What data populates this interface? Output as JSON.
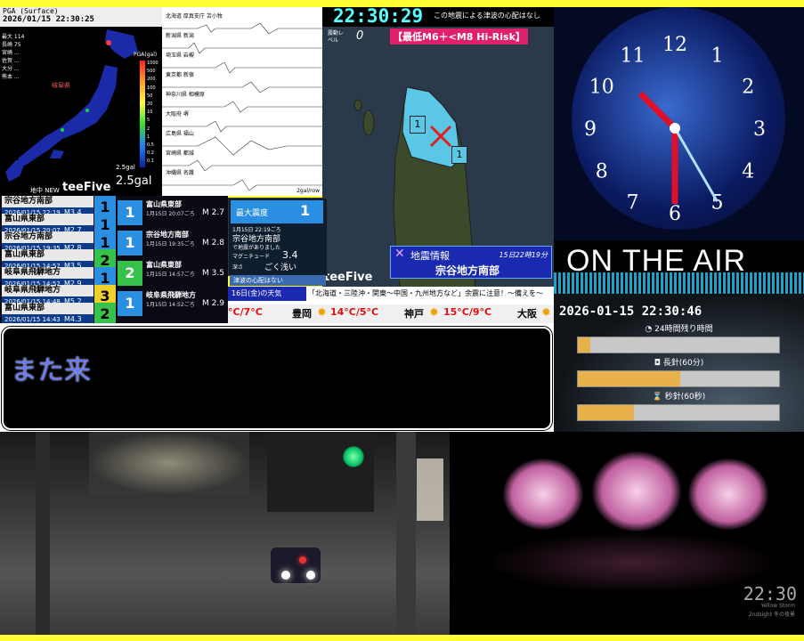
{
  "map": {
    "header": "PGA (Surface)",
    "timestamp": "2026/01/15 22:30:25",
    "scale_title": "PGA(gal)",
    "scale_ticks": [
      "1000",
      "500",
      "200",
      "100",
      "50",
      "20",
      "10",
      "5",
      "2",
      "1",
      "0.5",
      "0.2",
      "0.1"
    ],
    "threshold_label": "2.5gal",
    "max_label": "2.5gal",
    "brand": "teeFive",
    "subtitle": "地中 NEW",
    "left_list": [
      "最大 114",
      "長崎 75",
      "宮崎 ...",
      "佐賀 ...",
      "大分 ...",
      "熊本 ..."
    ]
  },
  "waves": {
    "stations": [
      "北海道 厚真支庁 苫小牧",
      "新潟県 新潟",
      "埼玉県 岩槻",
      "東京都 新宿",
      "神奈川県 相模原",
      "大阪府 堺",
      "広島県 福山",
      "宮崎県 都城",
      "沖縄県 名護"
    ],
    "footer": "2gal/row"
  },
  "quake": {
    "clock": "22:30:29",
    "tsunami_note": "この地震による津波の心配はなし",
    "level_label": "震動レベル",
    "level_value": "0",
    "risk": "【最低M6＋<M8 Hi-Risk】",
    "markers": [
      "1",
      "1"
    ],
    "info_title": "地震情報",
    "info_time": "15日22時19分",
    "region": "宗谷地方南部",
    "brand": "teeFive",
    "tsunami_footer": "津波の心配はない"
  },
  "list": {
    "rows": [
      {
        "name": "宗谷地方南部",
        "date": "2026/01/15 22:19",
        "mag": "M3.4",
        "int": "1",
        "color": "#2a8fe0"
      },
      {
        "name": "富山県東部",
        "date": "2026/01/15 20:07",
        "mag": "M2.7",
        "int": "1",
        "color": "#2a8fe0"
      },
      {
        "name": "宗谷地方南部",
        "date": "2026/01/15 19:35",
        "mag": "M2.8",
        "int": "1",
        "color": "#2a8fe0"
      },
      {
        "name": "富山県東部",
        "date": "2026/01/15 14:57",
        "mag": "M3.5",
        "int": "2",
        "color": "#35c14a"
      },
      {
        "name": "岐阜県飛騨地方",
        "date": "2026/01/15 14:52",
        "mag": "M2.9",
        "int": "1",
        "color": "#2a8fe0"
      },
      {
        "name": "岐阜県飛騨地方",
        "date": "2026/01/15 14:48",
        "mag": "M5.2",
        "int": "3",
        "color": "#f2d02c"
      },
      {
        "name": "富山県東部",
        "date": "2026/01/15 14:43",
        "mag": "M4.3",
        "int": "2",
        "color": "#35c14a"
      }
    ],
    "cards": [
      {
        "title": "富山県東部",
        "date": "1月15日 20:07ごろ",
        "mag": "M 2.7",
        "int": "1",
        "color": "#2a8fe0"
      },
      {
        "title": "宗谷地方南部",
        "date": "1月15日 19:35ごろ",
        "mag": "M 2.8",
        "int": "1",
        "color": "#2a8fe0"
      },
      {
        "title": "富山県東部",
        "date": "1月15日 14:57ごろ",
        "mag": "M 3.5",
        "int": "2",
        "color": "#35c14a"
      },
      {
        "title": "岐阜県飛騨地方",
        "date": "1月15日 14:52ごろ",
        "mag": "M 2.9",
        "int": "1",
        "color": "#2a8fe0"
      }
    ],
    "detail": {
      "header": "最大震度",
      "int": "1",
      "date": "1月15日 22:19ごろ",
      "region": "宗谷地方南部",
      "note": "で地震がありました",
      "mag_label": "マグニチュード",
      "mag": "3.4",
      "depth_label": "深さ",
      "depth": "ごく浅い"
    },
    "weather_day": "16日(金)の天気",
    "weather_banner": "「北海道・三陸沖・関東〜中国・九州地方など」余震に注意！〜備えを〜",
    "weather": [
      {
        "city": "",
        "temp": "°C/7°C"
      },
      {
        "city": "豊岡",
        "temp": "14°C/5°C"
      },
      {
        "city": "神戸",
        "temp": "15°C/9°C"
      },
      {
        "city": "大阪",
        "temp": ""
      }
    ]
  },
  "chat": {
    "message": "また来"
  },
  "clock": {
    "numbers": [
      "12",
      "1",
      "2",
      "3",
      "4",
      "5",
      "6",
      "7",
      "8",
      "9",
      "10",
      "11"
    ],
    "time": {
      "h": 10,
      "m": 30,
      "s": 25
    }
  },
  "onair": {
    "title": "ON THE AIR",
    "datetime": "2026-01-15 22:30:46",
    "bars": [
      {
        "label": "24時間残り時間",
        "progress": 0.06
      },
      {
        "label": "長針(60分)",
        "progress": 0.51
      },
      {
        "label": "秒針(60秒)",
        "progress": 0.28
      }
    ]
  },
  "cam2": {
    "clock": "22:30",
    "caption1": "Yellow Storm",
    "caption2": "2ndsight 冬の夜景"
  },
  "colors": {
    "frame": "#ffff33",
    "accent_blue": "#2a8fe0",
    "accent_green": "#35c14a",
    "accent_yellow": "#f2d02c",
    "bar_fill": "#e7b24b"
  }
}
